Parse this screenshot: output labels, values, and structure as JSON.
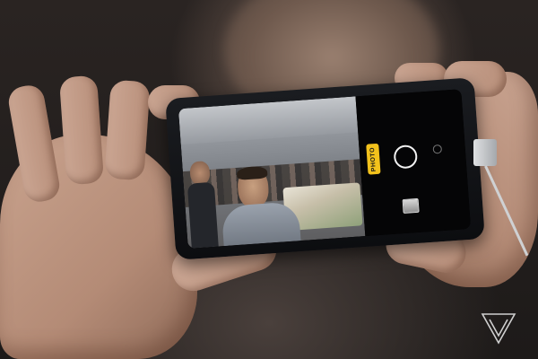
{
  "image": {
    "camera_mode_label": "PHOTO"
  },
  "icons": {
    "shutter": "shutter-ring-icon",
    "gallery": "gallery-thumbnail-icon",
    "watermark": "verge-logo-icon"
  }
}
